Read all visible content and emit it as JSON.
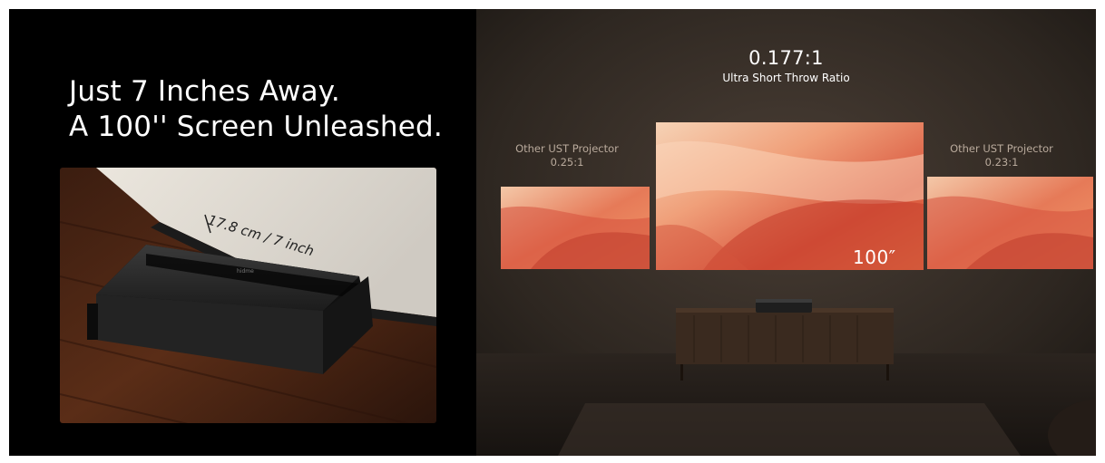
{
  "headline": {
    "line1": "Just 7 Inches Away.",
    "line2": "A 100'' Screen Unleashed."
  },
  "product_photo": {
    "measurement": "17.8 cm / 7 inch",
    "brand_mark": "hidme"
  },
  "comparison": {
    "center": {
      "ratio": "0.177:1",
      "label": "Ultra Short Throw Ratio",
      "size": "100″"
    },
    "left": {
      "label": "Other UST Projector",
      "ratio": "0.25:1"
    },
    "right": {
      "label": "Other UST Projector",
      "ratio": "0.23:1"
    }
  }
}
